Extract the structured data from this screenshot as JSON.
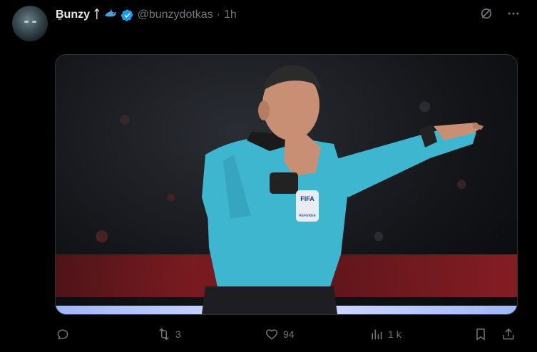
{
  "author": {
    "display_name": "Ḇunzy",
    "name_suffix": "ᛏ",
    "emoji_icon": "shark-emoji",
    "verified": true,
    "handle": "@bunzydotkas",
    "separator": "·",
    "timestamp": "1h"
  },
  "tweet": {
    "text": ""
  },
  "media": {
    "badge_text": "FIFA",
    "badge_subtext": "REFEREE"
  },
  "actions": {
    "reply_count": "",
    "retweet_count": "3",
    "like_count": "94",
    "views_count": "1 k"
  },
  "colors": {
    "background": "#000000",
    "text_primary": "#e7e9ea",
    "text_secondary": "#71767b",
    "verified_blue": "#1d9bf0",
    "jersey": "#3fb6cf"
  }
}
